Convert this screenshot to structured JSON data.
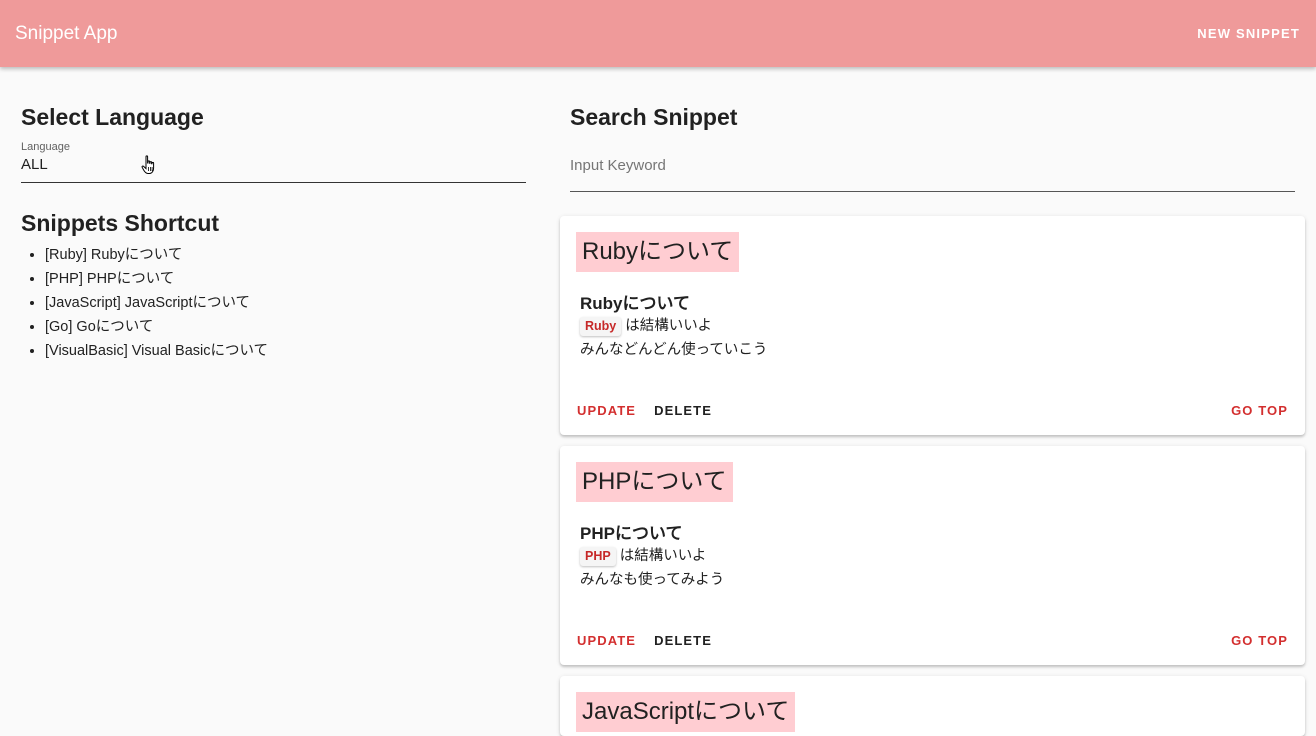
{
  "app": {
    "title": "Snippet App",
    "new_snippet_label": "NEW SNIPPET"
  },
  "colors": {
    "appbar": "#ef9a9a",
    "accent": "#d32f2f",
    "title_highlight": "#ffcdd2"
  },
  "left": {
    "select_heading": "Select Language",
    "select_label": "Language",
    "select_value": "ALL",
    "shortcut_heading": "Snippets Shortcut",
    "shortcuts": [
      "[Ruby] Rubyについて",
      "[PHP] PHPについて",
      "[JavaScript] JavaScriptについて",
      "[Go] Goについて",
      "[VisualBasic] Visual Basicについて"
    ]
  },
  "right": {
    "search_heading": "Search Snippet",
    "search_placeholder": "Input Keyword"
  },
  "cards": [
    {
      "title": "Rubyについて",
      "heading": "Rubyについて",
      "code": "Ruby",
      "line1_rest": "は結構いいよ",
      "line2": "みんなどんどん使っていこう",
      "update_label": "UPDATE",
      "delete_label": "DELETE",
      "gotop_label": "GO TOP"
    },
    {
      "title": "PHPについて",
      "heading": "PHPについて",
      "code": "PHP",
      "line1_rest": "は結構いいよ",
      "line2": "みんなも使ってみよう",
      "update_label": "UPDATE",
      "delete_label": "DELETE",
      "gotop_label": "GO TOP"
    },
    {
      "title": "JavaScriptについて"
    }
  ]
}
